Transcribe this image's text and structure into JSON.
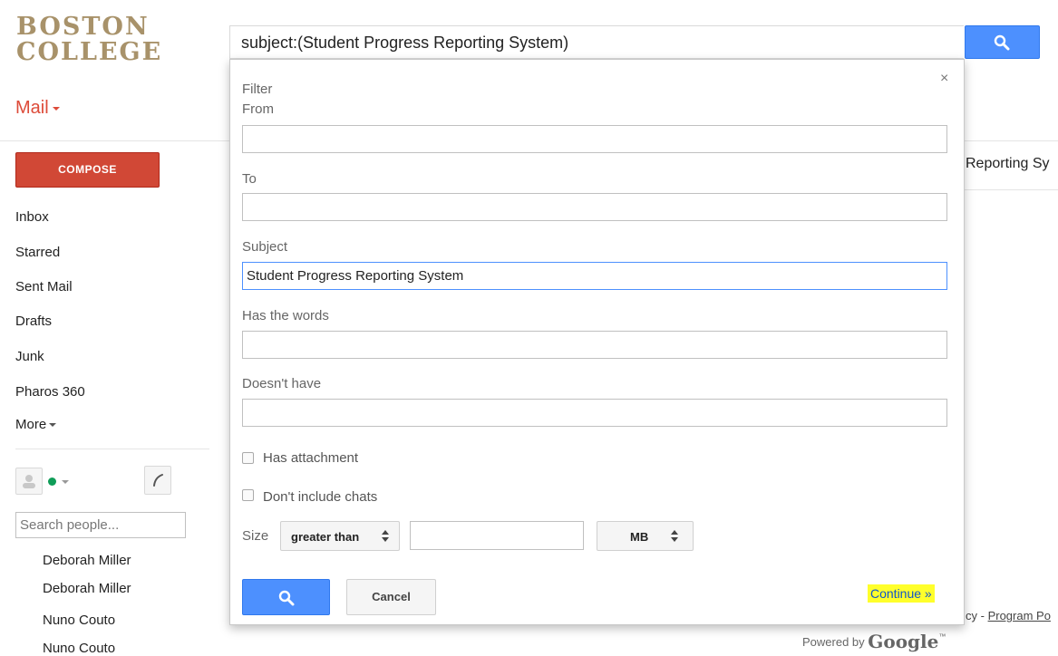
{
  "logo": {
    "line1": "BOSTON",
    "line2": "COLLEGE"
  },
  "search": {
    "query": "subject:(Student Progress Reporting System)"
  },
  "mail_label": "Mail",
  "compose_label": "COMPOSE",
  "nav": {
    "inbox": "Inbox",
    "starred": "Starred",
    "sent": "Sent Mail",
    "drafts": "Drafts",
    "junk": "Junk",
    "pharos": "Pharos 360",
    "more": "More"
  },
  "chat": {
    "search_placeholder": "Search people...",
    "contacts": [
      "Deborah Miller",
      "Deborah Miller",
      "Nuno Couto",
      "Nuno Couto"
    ]
  },
  "behind": {
    "subject_fragment": "Reporting Sy",
    "footer_fragment": "cy - ",
    "footer_link": "Program Po",
    "powered_by": "Powered by",
    "google": "Google",
    "tm": "™"
  },
  "filter": {
    "close": "×",
    "title": "Filter",
    "from_label": "From",
    "to_label": "To",
    "subject_label": "Subject",
    "subject_value": "Student Progress Reporting System",
    "has_words_label": "Has the words",
    "doesnt_have_label": "Doesn't have",
    "has_attachment_label": "Has attachment",
    "dont_include_chats_label": "Don't include chats",
    "size_label": "Size",
    "size_operator": "greater than",
    "size_unit": "MB",
    "cancel_label": "Cancel",
    "continue_label": "Continue »"
  },
  "colors": {
    "accent_blue": "#4d90fe",
    "compose_red": "#d14836",
    "mail_red": "#dd4b39",
    "highlight": "#ffff2b",
    "logo_gold": "#a8926a"
  }
}
